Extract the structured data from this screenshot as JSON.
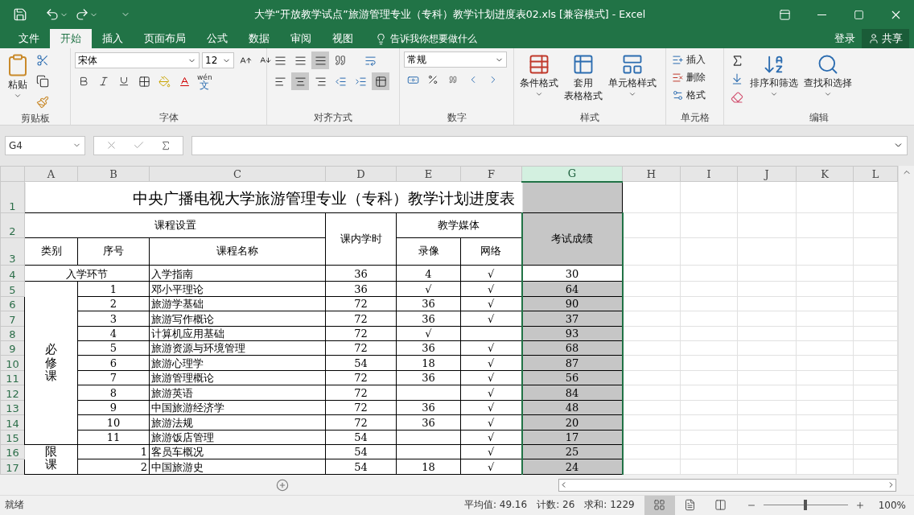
{
  "window": {
    "title": "大学“开放教学试点”旅游管理专业（专科）教学计划进度表02.xls  [兼容模式] - Excel"
  },
  "ribbon_tabs": [
    {
      "label": "文件",
      "selected": false
    },
    {
      "label": "开始",
      "selected": true
    },
    {
      "label": "插入",
      "selected": false
    },
    {
      "label": "页面布局",
      "selected": false
    },
    {
      "label": "公式",
      "selected": false
    },
    {
      "label": "数据",
      "selected": false
    },
    {
      "label": "审阅",
      "selected": false
    },
    {
      "label": "视图",
      "selected": false
    }
  ],
  "tell_me": {
    "placeholder": "告诉我你想要做什么"
  },
  "account": {
    "sign_in": "登录",
    "share": "共享"
  },
  "ribbon": {
    "clipboard": {
      "label": "剪贴板",
      "paste": "粘贴"
    },
    "font": {
      "label": "字体",
      "font": "宋体",
      "size": "12",
      "phonetic": "wén",
      "phonetic_char": "文"
    },
    "alignment": {
      "label": "对齐方式"
    },
    "number": {
      "label": "数字",
      "format": "常规"
    },
    "styles": {
      "label": "样式",
      "conditional": "条件格式",
      "table_format": [
        "套用",
        "表格格式"
      ],
      "cell_styles": "单元格样式"
    },
    "cells": {
      "label": "单元格",
      "insert": "插入",
      "delete": "删除",
      "format": "格式"
    },
    "editing": {
      "label": "编辑",
      "sort": "排序和筛选",
      "find": "查找和选择"
    }
  },
  "formula_bar": {
    "name_box": "G4"
  },
  "sheet": {
    "columns": [
      {
        "label": "A",
        "selected": false
      },
      {
        "label": "B",
        "selected": false
      },
      {
        "label": "C",
        "selected": false
      },
      {
        "label": "D",
        "selected": false
      },
      {
        "label": "E",
        "selected": false
      },
      {
        "label": "F",
        "selected": false
      },
      {
        "label": "G",
        "selected": true
      },
      {
        "label": "H",
        "selected": false
      },
      {
        "label": "I",
        "selected": false
      },
      {
        "label": "J",
        "selected": false
      },
      {
        "label": "K",
        "selected": false
      },
      {
        "label": "L",
        "selected": false
      }
    ],
    "title": "中央广播电视大学旅游管理专业（专科）教学计划进度表",
    "headers": {
      "setup": "课程设置",
      "hours": "课内学时",
      "media": "教学媒体",
      "score": "考试成绩",
      "category": "类别",
      "seq": "序号",
      "name": "课程名称",
      "video": "录像",
      "web": "网络"
    },
    "header_rows": [
      "1",
      "2",
      "3"
    ],
    "sections": [
      {
        "kind": "entry",
        "label": "入学环节",
        "courses": [
          {
            "row": "4",
            "name": "入学指南",
            "hours": "36",
            "video": "4",
            "web": "√",
            "score": "30",
            "selected": false
          }
        ]
      },
      {
        "kind": "required",
        "label": "必修课",
        "courses": [
          {
            "row": "5",
            "seq": "1",
            "name": "邓小平理论",
            "hours": "36",
            "video": "√",
            "web": "√",
            "score": "64",
            "selected": true
          },
          {
            "row": "6",
            "seq": "2",
            "name": "旅游学基础",
            "hours": "72",
            "video": "36",
            "web": "√",
            "score": "90",
            "selected": true
          },
          {
            "row": "7",
            "seq": "3",
            "name": "旅游写作概论",
            "hours": "72",
            "video": "36",
            "web": "√",
            "score": "37",
            "selected": true
          },
          {
            "row": "8",
            "seq": "4",
            "name": "计算机应用基础",
            "hours": "72",
            "video": "√",
            "score": "93",
            "selected": true
          },
          {
            "row": "9",
            "seq": "5",
            "name": "旅游资源与环境管理",
            "hours": "72",
            "video": "36",
            "web": "√",
            "score": "68",
            "selected": true
          },
          {
            "row": "10",
            "seq": "6",
            "name": "旅游心理学",
            "hours": "54",
            "video": "18",
            "web": "√",
            "score": "87",
            "selected": true
          },
          {
            "row": "11",
            "seq": "7",
            "name": "旅游管理概论",
            "hours": "72",
            "video": "36",
            "web": "√",
            "score": "56",
            "selected": true
          },
          {
            "row": "12",
            "seq": "8",
            "name": "旅游英语",
            "hours": "72",
            "web": "√",
            "score": "84",
            "selected": true
          },
          {
            "row": "13",
            "seq": "9",
            "name": "中国旅游经济学",
            "hours": "72",
            "video": "36",
            "web": "√",
            "score": "48",
            "selected": true
          },
          {
            "row": "14",
            "seq": "10",
            "name": "旅游法规",
            "hours": "72",
            "video": "36",
            "web": "√",
            "score": "20",
            "selected": true
          },
          {
            "row": "15",
            "seq": "11",
            "name": "旅游饭店管理",
            "hours": "54",
            "web": "√",
            "score": "17",
            "selected": true
          }
        ]
      },
      {
        "kind": "elective",
        "label": "限课",
        "courses": [
          {
            "row": "16",
            "seq": "1",
            "name": "客员车概况",
            "hours": "54",
            "web": "√",
            "score": "25",
            "selected": true
          },
          {
            "row": "17",
            "seq": "2",
            "name": "中国旅游史",
            "hours": "54",
            "video": "18",
            "web": "√",
            "score": "24",
            "selected": true
          }
        ]
      }
    ]
  },
  "status_bar": {
    "mode": "就绪",
    "stats": [
      "平均值: 49.16",
      "计数: 26",
      "求和: 1229"
    ],
    "views": [
      {
        "kind": "normal",
        "selected": true
      },
      {
        "kind": "layout",
        "selected": false
      },
      {
        "kind": "pagebreak",
        "selected": false
      }
    ],
    "zoom": {
      "level": 0.5,
      "label": "100%"
    }
  }
}
